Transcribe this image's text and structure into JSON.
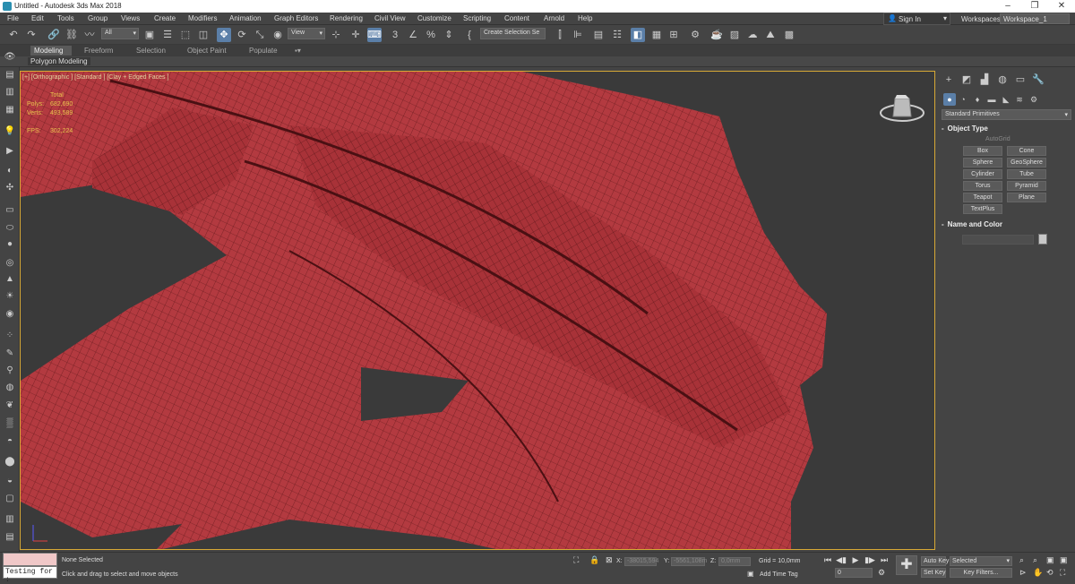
{
  "title": "Untitled - Autodesk 3ds Max 2018",
  "window_controls": {
    "minimize": "–",
    "maximize": "❐",
    "close": "✕"
  },
  "menu": [
    "File",
    "Edit",
    "Tools",
    "Group",
    "Views",
    "Create",
    "Modifiers",
    "Animation",
    "Graph Editors",
    "Rendering",
    "Civil View",
    "Customize",
    "Scripting",
    "Content",
    "Arnold",
    "Help"
  ],
  "account": {
    "sign_in": "Sign In",
    "workspaces_label": "Workspaces:",
    "workspace": "Workspace_1"
  },
  "toolbar": {
    "selection_filter": "All",
    "reference_coord": "View",
    "named_selection": "Create Selection Se",
    "snap_value": "3",
    "icons": [
      "undo-icon",
      "redo-icon",
      "link-icon",
      "unlink-icon",
      "bind-spacewarp-icon",
      "select-object-icon",
      "select-by-name-icon",
      "rect-region-icon",
      "window-crossing-icon",
      "select-move-icon",
      "select-rotate-icon",
      "select-scale-icon",
      "place-icon",
      "pivot-icon",
      "manipulate-icon",
      "keyboard-shortcut-icon",
      "snaps-toggle-icon",
      "angle-snap-icon",
      "percent-snap-icon",
      "spinner-snap-icon",
      "edit-named-sel-icon",
      "mirror-icon",
      "align-icon",
      "layer-explorer-icon",
      "toggle-ribbon-icon",
      "curve-editor-icon",
      "schematic-view-icon",
      "material-editor-icon",
      "render-setup-icon",
      "rendered-frame-icon",
      "render-icon",
      "render-cloud-icon",
      "a360-gallery-icon"
    ]
  },
  "ribbon": {
    "tabs": [
      "Modeling",
      "Freeform",
      "Selection",
      "Object Paint",
      "Populate"
    ],
    "active": "Modeling",
    "panel": "Polygon Modeling"
  },
  "viewport": {
    "label": "[+] [Orthographic ] [Standard ] [Clay + Edged Faces ]",
    "stats": {
      "total_label": "Total",
      "polys_label": "Polys:",
      "polys": "682,690",
      "verts_label": "Verts:",
      "verts": "493,589",
      "fps_label": "FPS:",
      "fps": "302,224"
    },
    "mesh_color": "#b3393f",
    "background_color": "#3a3a3a"
  },
  "command_panel": {
    "dropdown": "Standard Primitives",
    "object_type_title": "Object Type",
    "autogrid": "AutoGrid",
    "primitives": [
      "Box",
      "Cone",
      "Sphere",
      "GeoSphere",
      "Cylinder",
      "Tube",
      "Torus",
      "Pyramid",
      "Teapot",
      "Plane",
      "TextPlus"
    ],
    "name_color_title": "Name and Color",
    "rollout_toggle": "-"
  },
  "status": {
    "maxscript": "Testing for :",
    "selection": "None Selected",
    "prompt": "Click and drag to select and move objects",
    "x_label": "X:",
    "x_value": "-38015,594",
    "y_label": "Y:",
    "y_value": "-5561,108m",
    "z_label": "Z:",
    "z_value": "0,0mm",
    "grid": "Grid = 10,0mm",
    "add_time_tag": "Add Time Tag",
    "frame": "0",
    "auto_key": "Auto Key",
    "set_key": "Set Key",
    "key_selected": "Selected",
    "key_filters": "Key Filters..."
  }
}
